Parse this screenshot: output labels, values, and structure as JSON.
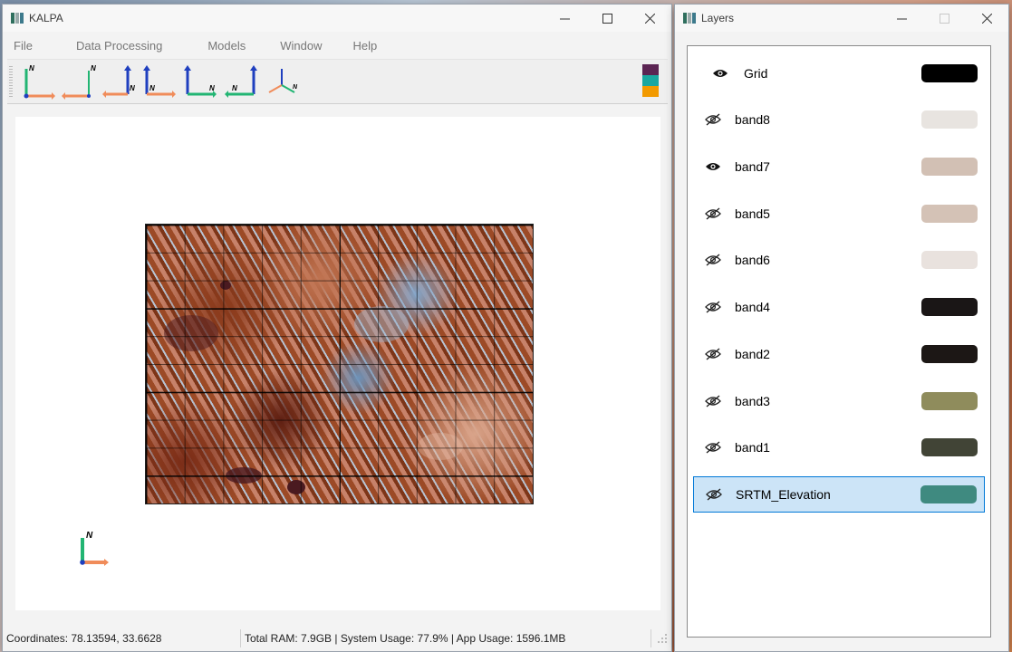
{
  "main_window": {
    "title": "KALPA",
    "menu": [
      "File",
      "Data Processing",
      "Models",
      "Window",
      "Help"
    ],
    "toolbar": {
      "buttons": [
        {
          "name": "view-north-xy-icon"
        },
        {
          "name": "view-north-xy-mirrored-icon"
        },
        {
          "name": "view-north-front-left-icon"
        },
        {
          "name": "view-north-front-right-icon"
        },
        {
          "name": "view-north-side-icon"
        },
        {
          "name": "view-north-side-mirrored-icon"
        },
        {
          "name": "view-3d-axes-icon"
        }
      ],
      "color_stack": [
        "#5b2453",
        "#1aa7a0",
        "#f29a00"
      ]
    },
    "map": {
      "description_layer": "SRTM_Elevation"
    },
    "compass_label": "N",
    "status": {
      "coordinates": "Coordinates: 78.13594, 33.6628",
      "system": "Total RAM: 7.9GB | System Usage: 77.9% | App Usage: 1596.1MB"
    }
  },
  "layers_window": {
    "title": "Layers",
    "layers": [
      {
        "name": "Grid",
        "visible": true,
        "color": "#000000",
        "selected": false
      },
      {
        "name": "band8",
        "visible": false,
        "color": "#e8e4e0",
        "selected": false
      },
      {
        "name": "band7",
        "visible": true,
        "color": "#d2c0b4",
        "selected": false
      },
      {
        "name": "band5",
        "visible": false,
        "color": "#d4c2b6",
        "selected": false
      },
      {
        "name": "band6",
        "visible": false,
        "color": "#e9e2de",
        "selected": false
      },
      {
        "name": "band4",
        "visible": false,
        "color": "#1a1616",
        "selected": false
      },
      {
        "name": "band2",
        "visible": false,
        "color": "#1c1715",
        "selected": false
      },
      {
        "name": "band3",
        "visible": false,
        "color": "#8f8c5c",
        "selected": false
      },
      {
        "name": "band1",
        "visible": false,
        "color": "#414436",
        "selected": false
      },
      {
        "name": "SRTM_Elevation",
        "visible": false,
        "color": "#3f8a80",
        "selected": true
      }
    ]
  }
}
